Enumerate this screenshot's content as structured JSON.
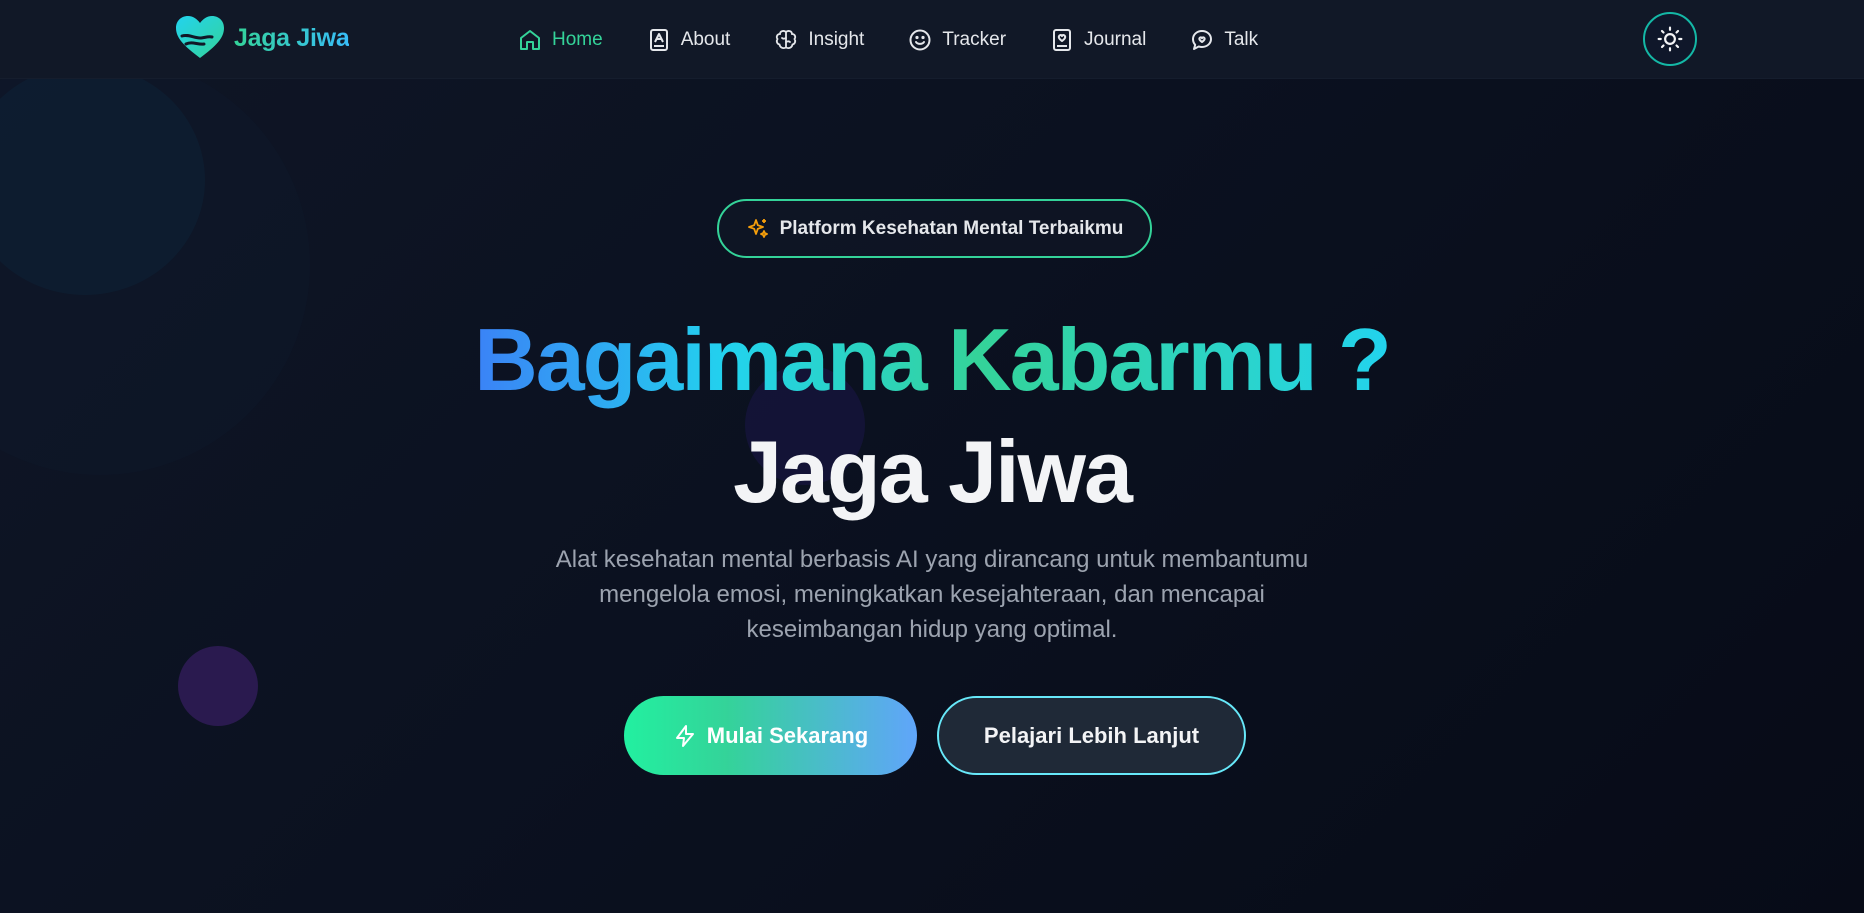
{
  "brand": {
    "name": "Jaga Jiwa",
    "logo_icon": "heart-hands-icon"
  },
  "nav": {
    "items": [
      {
        "label": "Home",
        "icon": "home-icon",
        "active": true
      },
      {
        "label": "About",
        "icon": "book-icon",
        "active": false
      },
      {
        "label": "Insight",
        "icon": "brain-icon",
        "active": false
      },
      {
        "label": "Tracker",
        "icon": "smile-icon",
        "active": false
      },
      {
        "label": "Journal",
        "icon": "journal-icon",
        "active": false
      },
      {
        "label": "Talk",
        "icon": "chat-heart-icon",
        "active": false
      }
    ],
    "theme_toggle_icon": "sun-icon"
  },
  "hero": {
    "badge": "Platform Kesehatan Mental Terbaikmu",
    "badge_icon": "sparkles-icon",
    "headline_line1": "Bagaimana Kabarmu ?",
    "headline_line2": "Jaga Jiwa",
    "subtitle": "Alat kesehatan mental berbasis AI yang dirancang untuk membantumu mengelola emosi, meningkatkan kesejahteraan, dan mencapai keseimbangan hidup yang optimal.",
    "primary_button": "Mulai Sekarang",
    "primary_button_icon": "lightning-icon",
    "secondary_button": "Pelajari Lebih Lanjut"
  },
  "colors": {
    "accent_green": "#34d399",
    "accent_blue": "#3b82f6",
    "accent_cyan": "#22d3ee",
    "background": "#0b1120",
    "nav_background": "#111827"
  }
}
